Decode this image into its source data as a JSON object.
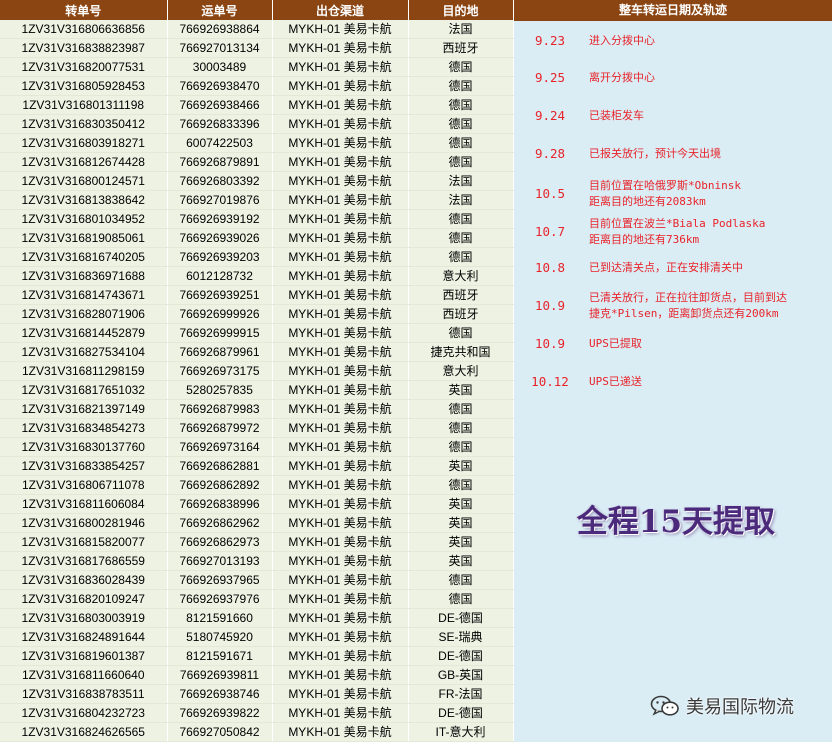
{
  "headers": [
    "转单号",
    "运单号",
    "出仓渠道",
    "目的地"
  ],
  "track_header": "整车转运日期及轨迹",
  "rows": [
    [
      "1ZV31V316806636856",
      "766926938864",
      "MYKH-01 美易卡航",
      "法国"
    ],
    [
      "1ZV31V316838823987",
      "766927013134",
      "MYKH-01 美易卡航",
      "西班牙"
    ],
    [
      "1ZV31V316820077531",
      "30003489",
      "MYKH-01 美易卡航",
      "德国"
    ],
    [
      "1ZV31V316805928453",
      "766926938470",
      "MYKH-01 美易卡航",
      "德国"
    ],
    [
      "1ZV31V316801311198",
      "766926938466",
      "MYKH-01 美易卡航",
      "德国"
    ],
    [
      "1ZV31V316830350412",
      "766926833396",
      "MYKH-01 美易卡航",
      "德国"
    ],
    [
      "1ZV31V316803918271",
      "6007422503",
      "MYKH-01 美易卡航",
      "德国"
    ],
    [
      "1ZV31V316812674428",
      "766926879891",
      "MYKH-01 美易卡航",
      "德国"
    ],
    [
      "1ZV31V316800124571",
      "766926803392",
      "MYKH-01 美易卡航",
      "法国"
    ],
    [
      "1ZV31V316813838642",
      "766927019876",
      "MYKH-01 美易卡航",
      "法国"
    ],
    [
      "1ZV31V316801034952",
      "766926939192",
      "MYKH-01 美易卡航",
      "德国"
    ],
    [
      "1ZV31V316819085061",
      "766926939026",
      "MYKH-01 美易卡航",
      "德国"
    ],
    [
      "1ZV31V316816740205",
      "766926939203",
      "MYKH-01 美易卡航",
      "德国"
    ],
    [
      "1ZV31V316836971688",
      "6012128732",
      "MYKH-01 美易卡航",
      "意大利"
    ],
    [
      "1ZV31V316814743671",
      "766926939251",
      "MYKH-01 美易卡航",
      "西班牙"
    ],
    [
      "1ZV31V316828071906",
      "766926999926",
      "MYKH-01 美易卡航",
      "西班牙"
    ],
    [
      "1ZV31V316814452879",
      "766926999915",
      "MYKH-01 美易卡航",
      "德国"
    ],
    [
      "1ZV31V316827534104",
      "766926879961",
      "MYKH-01 美易卡航",
      "捷克共和国"
    ],
    [
      "1ZV31V316811298159",
      "766926973175",
      "MYKH-01 美易卡航",
      "意大利"
    ],
    [
      "1ZV31V316817651032",
      "5280257835",
      "MYKH-01 美易卡航",
      "英国"
    ],
    [
      "1ZV31V316821397149",
      "766926879983",
      "MYKH-01 美易卡航",
      "德国"
    ],
    [
      "1ZV31V316834854273",
      "766926879972",
      "MYKH-01 美易卡航",
      "德国"
    ],
    [
      "1ZV31V316830137760",
      "766926973164",
      "MYKH-01 美易卡航",
      "德国"
    ],
    [
      "1ZV31V316833854257",
      "766926862881",
      "MYKH-01 美易卡航",
      "英国"
    ],
    [
      "1ZV31V316806711078",
      "766926862892",
      "MYKH-01 美易卡航",
      "德国"
    ],
    [
      "1ZV31V316811606084",
      "766926838996",
      "MYKH-01 美易卡航",
      "英国"
    ],
    [
      "1ZV31V316800281946",
      "766926862962",
      "MYKH-01 美易卡航",
      "英国"
    ],
    [
      "1ZV31V316815820077",
      "766926862973",
      "MYKH-01 美易卡航",
      "英国"
    ],
    [
      "1ZV31V316817686559",
      "766927013193",
      "MYKH-01 美易卡航",
      "英国"
    ],
    [
      "1ZV31V316836028439",
      "766926937965",
      "MYKH-01 美易卡航",
      "德国"
    ],
    [
      "1ZV31V316820109247",
      "766926937976",
      "MYKH-01 美易卡航",
      "德国"
    ],
    [
      "1ZV31V316803003919",
      "8121591660",
      "MYKH-01 美易卡航",
      "DE-德国"
    ],
    [
      "1ZV31V316824891644",
      "5180745920",
      "MYKH-01 美易卡航",
      "SE-瑞典"
    ],
    [
      "1ZV31V316819601387",
      "8121591671",
      "MYKH-01 美易卡航",
      "DE-德国"
    ],
    [
      "1ZV31V316811660640",
      "766926939811",
      "MYKH-01 美易卡航",
      "GB-英国"
    ],
    [
      "1ZV31V316838783511",
      "766926938746",
      "MYKH-01 美易卡航",
      "FR-法国"
    ],
    [
      "1ZV31V316804232723",
      "766926939822",
      "MYKH-01 美易卡航",
      "DE-德国"
    ],
    [
      "1ZV31V316824626565",
      "766927050842",
      "MYKH-01 美易卡航",
      "IT-意大利"
    ]
  ],
  "tracking": [
    {
      "date": "9.23",
      "text": "进入分拨中心"
    },
    {
      "date": "9.25",
      "text": "离开分拨中心"
    },
    {
      "date": "9.24",
      "text": "已装柜发车"
    },
    {
      "date": "9.28",
      "text": "已报关放行，预计今天出境"
    },
    {
      "date": "10.5",
      "text": "目前位置在哈俄罗斯*Obninsk\n距离目的地还有2083km"
    },
    {
      "date": "10.7",
      "text": "目前位置在波兰*Biala Podlaska\n距离目的地还有736km"
    },
    {
      "date": "10.8",
      "text": "已到达清关点，正在安排清关中"
    },
    {
      "date": "10.9",
      "text": "已清关放行，正在拉往卸货点，目前到达\n捷克*Pilsen，距离卸货点还有200km"
    },
    {
      "date": "10.9",
      "text": "UPS已提取"
    },
    {
      "date": "10.12",
      "text": "UPS已递送"
    }
  ],
  "summary": "全程15天提取",
  "watermark": "美易国际物流",
  "colors": {
    "header_bg": "#8b4513",
    "table_bg": "#eef2e3",
    "panel_bg": "#daedf5",
    "track_text": "#e8232a",
    "summary_text": "#4b2a7c"
  },
  "icons": {
    "watermark": "wechat-icon"
  }
}
